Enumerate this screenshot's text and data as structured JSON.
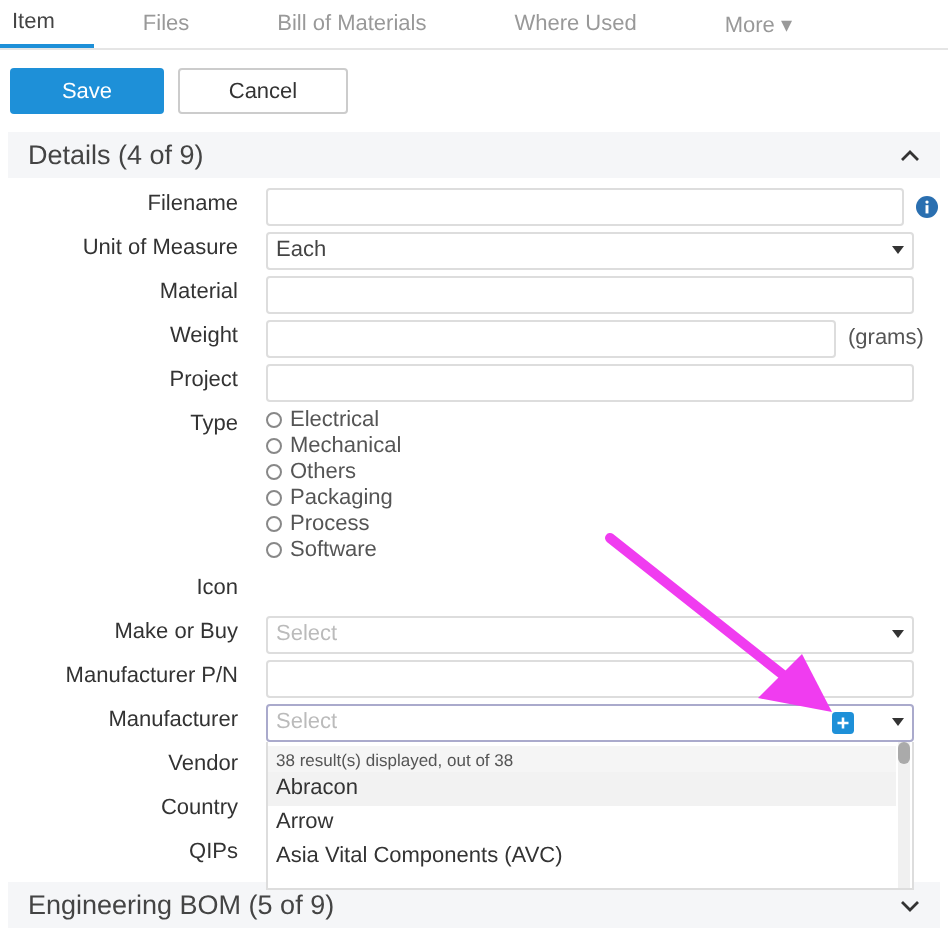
{
  "tabs": [
    {
      "label": "Item",
      "selected": true
    },
    {
      "label": "Files",
      "selected": false
    },
    {
      "label": "Bill of Materials",
      "selected": false
    },
    {
      "label": "Where Used",
      "selected": false
    },
    {
      "label": "More ▾",
      "selected": false
    }
  ],
  "buttons": {
    "save": "Save",
    "cancel": "Cancel"
  },
  "sections": [
    {
      "title": "Details (4 of 9)",
      "expanded": true
    },
    {
      "title": "Engineering BOM (5 of 9)",
      "expanded": false
    }
  ],
  "fields": [
    {
      "label": "Filename",
      "kind": "text",
      "info": true
    },
    {
      "label": "Unit of Measure",
      "kind": "select",
      "value": "Each"
    },
    {
      "label": "Material",
      "kind": "text"
    },
    {
      "label": "Weight",
      "kind": "unit",
      "unit": "(grams)"
    },
    {
      "label": "Project",
      "kind": "text"
    },
    {
      "label": "Type",
      "kind": "radio",
      "options": [
        {
          "label": "Electrical",
          "selected": false
        },
        {
          "label": "Mechanical",
          "selected": false
        },
        {
          "label": "Others",
          "selected": false
        },
        {
          "label": "Packaging",
          "selected": false
        },
        {
          "label": "Process",
          "selected": false
        },
        {
          "label": "Software",
          "selected": false
        }
      ]
    },
    {
      "label": "Icon",
      "kind": "empty"
    },
    {
      "label": "Make or Buy",
      "kind": "select",
      "placeholder": "Select"
    },
    {
      "label": "Manufacturer P/N",
      "kind": "text"
    },
    {
      "label": "Manufacturer",
      "kind": "combo",
      "placeholder": "Select",
      "results": "38 result(s) displayed, out of 38",
      "items": [
        {
          "label": "Abracon",
          "selected": true
        },
        {
          "label": "Arrow",
          "selected": false
        },
        {
          "label": "Asia Vital Components (AVC)",
          "selected": false
        }
      ]
    },
    {
      "label": "Vendor",
      "kind": "empty"
    },
    {
      "label": "Country",
      "kind": "empty"
    },
    {
      "label": "QIPs",
      "kind": "empty"
    }
  ]
}
